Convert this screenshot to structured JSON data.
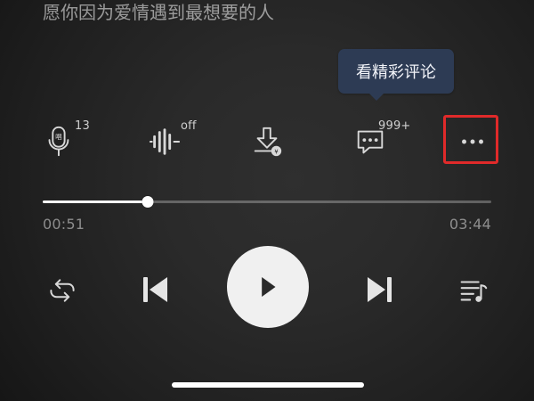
{
  "lyric": {
    "text": "愿你因为爱情遇到最想要的人"
  },
  "tooltip": {
    "text": "看精彩评论"
  },
  "toolbar": {
    "sing_badge": "13",
    "effect_badge": "off",
    "comment_badge": "999+"
  },
  "progress": {
    "current_time": "00:51",
    "total_time": "03:44",
    "value": 0.234
  }
}
